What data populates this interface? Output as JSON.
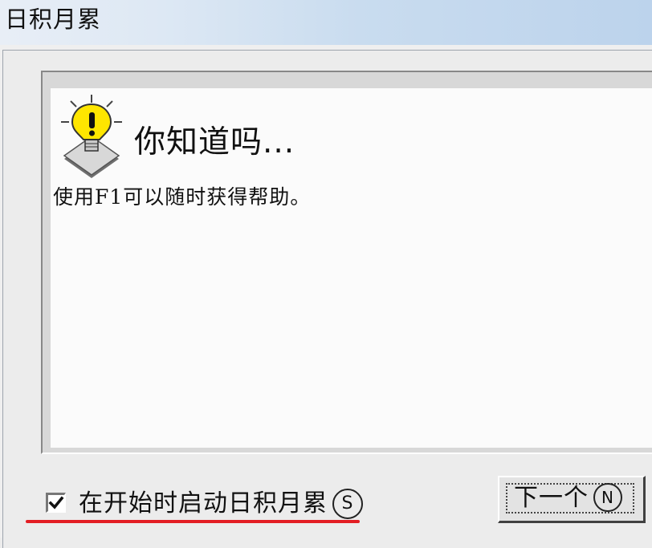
{
  "window": {
    "title": "日积月累"
  },
  "content": {
    "heading": "你知道吗...",
    "tip": "使用F1可以随时获得帮助。"
  },
  "checkbox": {
    "label": "在开始时启动日积月累",
    "accelerator": "S",
    "checked": true
  },
  "buttons": {
    "next_label": "下一个",
    "next_accelerator": "N"
  },
  "icons": {
    "bulb": "lightbulb-icon"
  },
  "colors": {
    "highlight_underline": "#e31e24",
    "bulb_yellow": "#ffe600"
  }
}
